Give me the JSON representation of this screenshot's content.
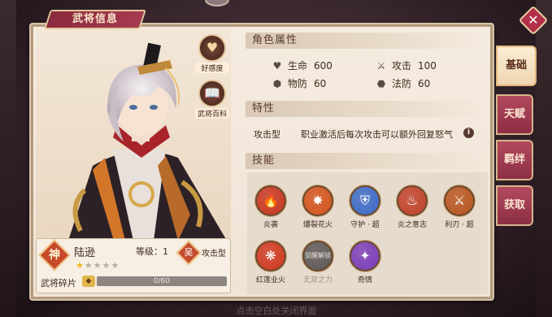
{
  "panel": {
    "title": "武将信息"
  },
  "close_label": "✕",
  "side_buttons": [
    {
      "label": "好感度",
      "icon": "♥"
    },
    {
      "label": "武将百科",
      "icon": "📖"
    }
  ],
  "hero": {
    "rank_badge": "神",
    "name": "陆逊",
    "level_label": "等级：1",
    "stars_on": "★",
    "stars_off": "★★★★",
    "faction_badge": "吴",
    "class": "攻击型",
    "shard_label": "武将碎片",
    "shard_icon": "◆",
    "shard_progress": "0/60",
    "shard_fraction": 0.0
  },
  "sections": {
    "attributes": "角色属性",
    "trait": "特性",
    "skills": "技能"
  },
  "attributes": [
    {
      "icon": "♥",
      "label": "生命",
      "value": "600"
    },
    {
      "icon": "⚔",
      "label": "攻击",
      "value": "100"
    },
    {
      "icon": "⬢",
      "label": "物防",
      "value": "60"
    },
    {
      "icon": "⬣",
      "label": "法防",
      "value": "60"
    }
  ],
  "trait": {
    "name": "攻击型",
    "desc": "职业激活后每次攻击可以额外回复怒气",
    "info_icon": "i"
  },
  "skills": [
    {
      "name": "炎袭",
      "color": "#c8341e",
      "icon": "🔥"
    },
    {
      "name": "爆裂花火",
      "color": "#d4521c",
      "icon": "✸"
    },
    {
      "name": "守护 · 超",
      "color": "#3a6ac8",
      "icon": "⛨"
    },
    {
      "name": "炎之意志",
      "color": "#c2402a",
      "icon": "♨"
    },
    {
      "name": "利刃 · 超",
      "color": "#b8541e",
      "icon": "⚔"
    },
    {
      "name": "红莲业火",
      "color": "#d0361e",
      "icon": "❋"
    },
    {
      "name": "无双之力",
      "color": "#5c5656",
      "icon": "",
      "locked_text": "觉醒解锁"
    },
    {
      "name": "奇情",
      "color": "#7a3ab8",
      "icon": "✦"
    }
  ],
  "tabs": [
    {
      "label": "基础",
      "active": true
    },
    {
      "label": "天赋",
      "active": false
    },
    {
      "label": "羁绊",
      "active": false
    },
    {
      "label": "获取",
      "active": false
    }
  ],
  "footer_text": "点击空白处关闭界面"
}
